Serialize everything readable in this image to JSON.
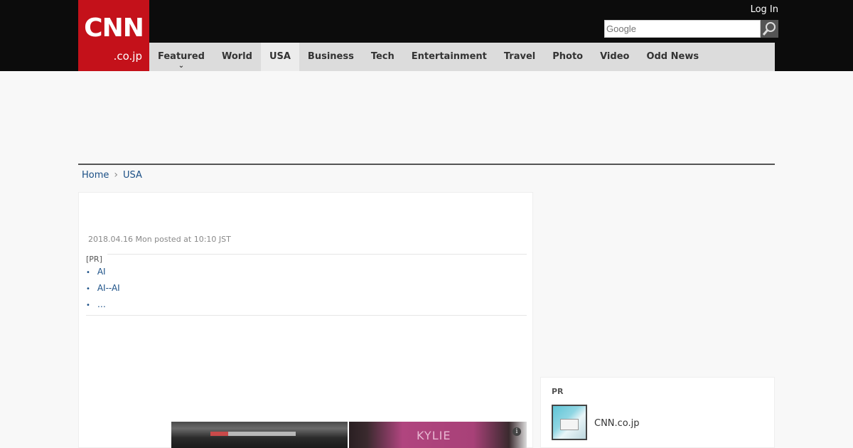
{
  "header": {
    "logo_main": "CNN",
    "logo_sub": ".co.jp",
    "login_label": "Log In",
    "search_placeholder": "Google"
  },
  "nav": {
    "items": [
      {
        "label": "Featured",
        "dropdown": true,
        "active": false
      },
      {
        "label": "World",
        "active": false
      },
      {
        "label": "USA",
        "active": true
      },
      {
        "label": "Business",
        "active": false
      },
      {
        "label": "Tech",
        "active": false
      },
      {
        "label": "Entertainment",
        "active": false
      },
      {
        "label": "Travel",
        "active": false
      },
      {
        "label": "Photo",
        "active": false
      },
      {
        "label": "Video",
        "active": false
      },
      {
        "label": "Odd News",
        "active": false
      }
    ],
    "caret": "⌄"
  },
  "breadcrumb": {
    "home": "Home",
    "separator": "›",
    "current": "USA"
  },
  "article": {
    "date": "2018.04.16 Mon posted at 10:10 JST"
  },
  "pr": {
    "label": "[PR]",
    "bullet": "•",
    "links": [
      "AI",
      "AI--AI",
      "…"
    ]
  },
  "thumbs": {
    "brand_text": "KYLIE",
    "info_glyph": "i"
  },
  "sidebar": {
    "pr_label": "PR",
    "item_text": "CNN.co.jp"
  },
  "colors": {
    "topbar": "#0c0c0c",
    "logo": "#c4111a",
    "nav": "#dcdcdc",
    "link": "#1a4f86"
  }
}
